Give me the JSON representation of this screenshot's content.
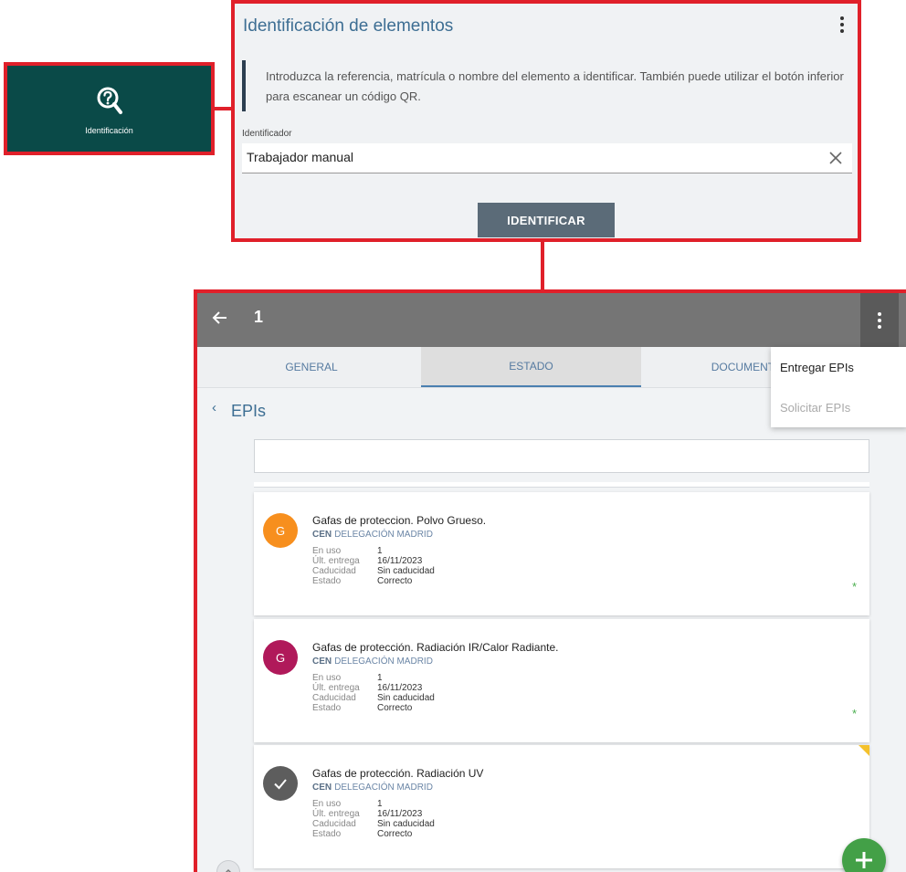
{
  "tile": {
    "label": "Identificación",
    "icon": "search-question-icon",
    "background": "#0a4a48"
  },
  "ident": {
    "title": "Identificación de elementos",
    "note": "Introduzca la referencia, matrícula o nombre del elemento a identificar. También puede utilizar el botón inferior para escanear un código QR.",
    "field_label": "Identificador",
    "field_value": "Trabajador manual",
    "button": "IDENTIFICAR"
  },
  "detail": {
    "record_id": "1",
    "tabs": [
      "GENERAL",
      "ESTADO",
      "DOCUMENTOS"
    ],
    "active_tab": "ESTADO",
    "menu": [
      "Entregar EPIs",
      "Solicitar EPIs"
    ],
    "section_title": "EPIs",
    "search_placeholder": "",
    "cards": [
      {
        "initial": "G",
        "color": "#f78f1e",
        "title": "Gafas de proteccion. Polvo Grueso.",
        "prefix": "CEN",
        "location": "DELEGACIÓN MADRID",
        "fields": [
          [
            "En uso",
            "1"
          ],
          [
            "Últ. entrega",
            "16/11/2023"
          ],
          [
            "Caducidad",
            "Sin caducidad"
          ],
          [
            "Estado",
            "Correcto"
          ]
        ],
        "status_mark": "*"
      },
      {
        "initial": "G",
        "color": "#b0195a",
        "title": "Gafas de protección. Radiación IR/Calor Radiante.",
        "prefix": "CEN",
        "location": "DELEGACIÓN MADRID",
        "fields": [
          [
            "En uso",
            "1"
          ],
          [
            "Últ. entrega",
            "16/11/2023"
          ],
          [
            "Caducidad",
            "Sin caducidad"
          ],
          [
            "Estado",
            "Correcto"
          ]
        ],
        "status_mark": "*"
      },
      {
        "initial": "check",
        "color": "#5d5d5d",
        "title": "Gafas de protección. Radiación UV",
        "prefix": "CEN",
        "location": "DELEGACIÓN MADRID",
        "fields": [
          [
            "En uso",
            "1"
          ],
          [
            "Últ. entrega",
            "16/11/2023"
          ],
          [
            "Caducidad",
            "Sin caducidad"
          ],
          [
            "Estado",
            "Correcto"
          ]
        ],
        "status_mark": ""
      }
    ],
    "fab_icon": "plus-icon",
    "accent": "#e0202a"
  }
}
